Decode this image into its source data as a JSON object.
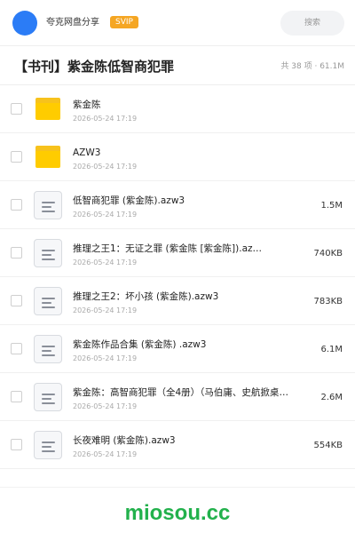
{
  "colors": {
    "accent_blue": "#2b7cf6",
    "svip_orange": "#f5a623",
    "folder_yellow": "#ffcc00",
    "watermark_green": "#22b14c"
  },
  "topbar": {
    "avatar_icon": "user-avatar",
    "user_name": "夸克网盘分享",
    "badge": "SVIP",
    "search_placeholder": "搜索"
  },
  "folder": {
    "title": "【书刊】紫金陈低智商犯罪",
    "meta": "共 38 项 · 61.1M"
  },
  "files": [
    {
      "type": "folder",
      "icon": "folder-icon",
      "name": "紫金陈",
      "date": "2026-05-24 17:19",
      "size": ""
    },
    {
      "type": "folder",
      "icon": "folder-icon",
      "name": "AZW3",
      "date": "2026-05-24 17:19",
      "size": ""
    },
    {
      "type": "file",
      "icon": "document-icon",
      "name": "低智商犯罪 (紫金陈).azw3",
      "date": "2026-05-24 17:19",
      "size": "1.5M"
    },
    {
      "type": "file",
      "icon": "document-icon",
      "name": "推理之王1：无证之罪 (紫金陈 [紫金陈]).az…",
      "date": "2026-05-24 17:19",
      "size": "740KB"
    },
    {
      "type": "file",
      "icon": "document-icon",
      "name": "推理之王2：坏小孩 (紫金陈).azw3",
      "date": "2026-05-24 17:19",
      "size": "783KB"
    },
    {
      "type": "file",
      "icon": "document-icon",
      "name": "紫金陈作品合集 (紫金陈) .azw3",
      "date": "2026-05-24 17:19",
      "size": "6.1M"
    },
    {
      "type": "file",
      "icon": "document-icon",
      "name": "紫金陈：高智商犯罪（全4册）（马伯庸、史航掀桌推荐…",
      "date": "2026-05-24 17:19",
      "size": "2.6M"
    },
    {
      "type": "file",
      "icon": "document-icon",
      "name": "长夜难明 (紫金陈).azw3",
      "date": "2026-05-24 17:19",
      "size": "554KB"
    }
  ],
  "watermark": "miosou.cc"
}
